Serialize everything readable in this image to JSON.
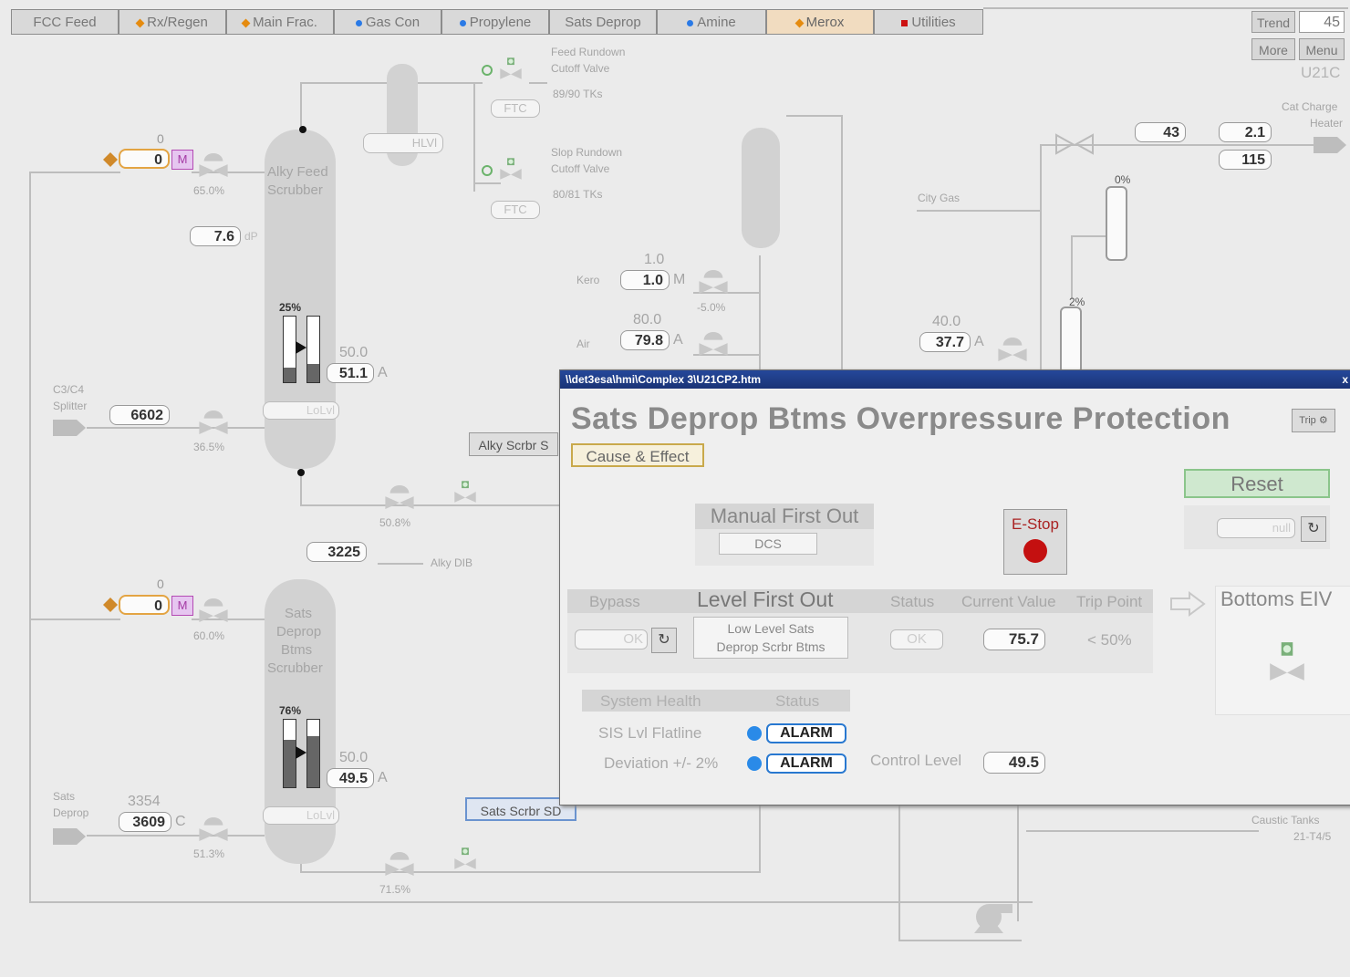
{
  "nav": {
    "tabs": [
      {
        "label": "FCC Feed",
        "marker": ""
      },
      {
        "label": "Rx/Regen",
        "marker": "orange"
      },
      {
        "label": "Main Frac.",
        "marker": "orange"
      },
      {
        "label": "Gas Con",
        "marker": "blue"
      },
      {
        "label": "Propylene",
        "marker": "blue"
      },
      {
        "label": "Sats Deprop",
        "marker": ""
      },
      {
        "label": "Amine",
        "marker": "blue"
      },
      {
        "label": "Merox",
        "marker": "orange"
      },
      {
        "label": "Utilities",
        "marker": "red"
      }
    ],
    "trend_label": "Trend",
    "trend_value": "45",
    "more_label": "More",
    "menu_label": "Menu",
    "unit_id": "U21C"
  },
  "graphic": {
    "feed_rundown": {
      "line1": "Feed Rundown",
      "line2": "Cutoff Valve",
      "tks": "89/90 TKs",
      "ftc": "FTC"
    },
    "slop_rundown": {
      "line1": "Slop Rundown",
      "line2": "Cutoff Valve",
      "tks": "80/81 TKs",
      "ftc": "FTC"
    },
    "hlvl": "HLVl",
    "alky_feed": {
      "line1": "Alky Feed",
      "line2": "Scrubber",
      "sp": "0",
      "pv": "0",
      "mode": "M",
      "valve_pct": "65.0%",
      "dp": "7.6",
      "dp_unit": "dP",
      "level_pct": "25%",
      "level_sp": "50.0",
      "level_pv": "51.1",
      "level_mode": "A",
      "lolvl": "LoLvl"
    },
    "c3c4_splitter": {
      "line1": "C3/C4",
      "line2": "Splitter",
      "value": "6602",
      "valve_pct": "36.5%"
    },
    "alky_scrbr_s": "Alky Scrbr S",
    "mid_valve_pct": "50.8%",
    "alky_dib": {
      "value": "3225",
      "label": "Alky DIB"
    },
    "sats_deprop_scrubber": {
      "line1": "Sats",
      "line2": "Deprop",
      "line3": "Btms",
      "line4": "Scrubber",
      "sp": "0",
      "pv": "0",
      "mode": "M",
      "valve_pct": "60.0%",
      "level_pct": "76%",
      "level_sp": "50.0",
      "level_pv": "49.5",
      "level_mode": "A",
      "lolvl": "LoLvl"
    },
    "sats_deprop_feed": {
      "line1": "Sats",
      "line2": "Deprop",
      "sp": "3354",
      "pv": "3609",
      "mode": "C",
      "valve_pct": "51.3%"
    },
    "sats_scrbr_sd": "Sats Scrbr SD",
    "bottom_valve_pct": "71.5%",
    "kero": {
      "label": "Kero",
      "sp": "1.0",
      "pv": "1.0",
      "mode": "M",
      "valve_pct": "-5.0%"
    },
    "air": {
      "label": "Air",
      "sp": "80.0",
      "pv": "79.8",
      "mode": "A"
    },
    "city_gas": {
      "label": "City Gas",
      "sp": "40.0",
      "pv": "37.7",
      "mode": "A"
    },
    "cat_charge": {
      "line1": "Cat Charge",
      "line2": "Heater",
      "v1": "43",
      "v2": "2.1",
      "v3": "115"
    },
    "pct_0": "0%",
    "pct_2": "2%",
    "caustic": {
      "line1": "Caustic Tanks",
      "line2": "21-T4/5"
    }
  },
  "popup": {
    "path": "\\\\det3esa\\hmi\\Complex 3\\U21CP2.htm",
    "close": "x",
    "title": "Sats Deprop Btms Overpressure Protection",
    "trip_button": "Trip",
    "cause_effect": "Cause & Effect",
    "reset": "Reset",
    "reset_field": "null",
    "manual_first_out": "Manual First Out",
    "dcs": "DCS",
    "estop": "E-Stop",
    "headers": {
      "bypass": "Bypass",
      "level_first_out": "Level First Out",
      "status": "Status",
      "current_value": "Current Value",
      "trip_point": "Trip Point"
    },
    "row": {
      "bypass_value": "OK",
      "desc1": "Low Level Sats",
      "desc2": "Deprop Scrbr Btms",
      "status": "OK",
      "current_value": "75.7",
      "trip_point": "< 50%"
    },
    "bottoms_eiv": "Bottoms EIV",
    "health": {
      "title": "System Health",
      "status_header": "Status",
      "rows": [
        {
          "label": "SIS Lvl Flatline",
          "status": "ALARM"
        },
        {
          "label": "Deviation +/- 2%",
          "status": "ALARM"
        }
      ]
    },
    "control_level_label": "Control Level",
    "control_level_value": "49.5"
  },
  "colors": {
    "alarm_blue": "#2a8ae8",
    "estop_red": "#c41010",
    "merox_tab": "#f1dcc0",
    "reset_green": "#cfe8cf"
  }
}
